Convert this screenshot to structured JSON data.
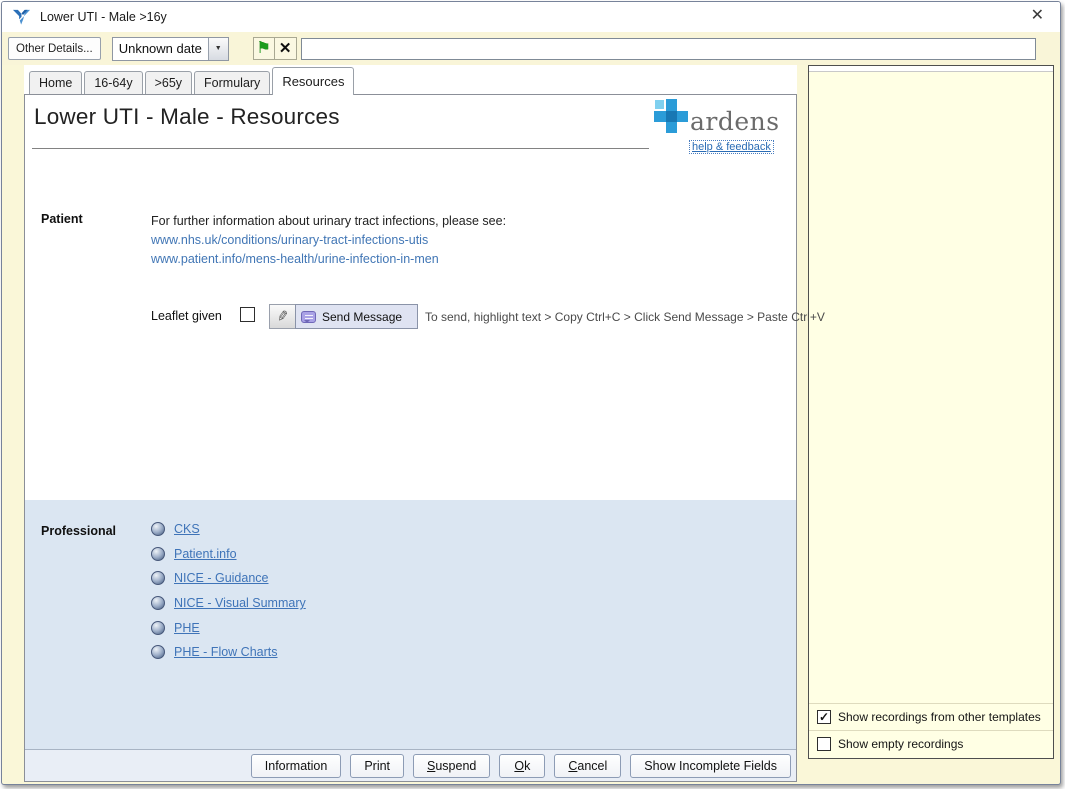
{
  "window": {
    "title": "Lower UTI - Male >16y"
  },
  "icons": {
    "close": "✕",
    "flag": "⚑",
    "clear": "✕",
    "dropdown": "▼",
    "pencil": "✎",
    "check": "✓"
  },
  "toolbar": {
    "other_details": "Other Details...",
    "date_value": "Unknown date",
    "search_value": ""
  },
  "tabs": [
    {
      "label": "Home",
      "active": false
    },
    {
      "label": "16-64y",
      "active": false
    },
    {
      "label": ">65y",
      "active": false
    },
    {
      "label": "Formulary",
      "active": false
    },
    {
      "label": "Resources",
      "active": true
    }
  ],
  "main": {
    "heading": "Lower UTI - Male - Resources",
    "logo": {
      "brand": "ardens",
      "help_link": "help & feedback"
    },
    "patient": {
      "section_label": "Patient",
      "intro": "For further information about urinary tract infections, please see:",
      "links": [
        "www.nhs.uk/conditions/urinary-tract-infections-utis",
        "www.patient.info/mens-health/urine-infection-in-men"
      ],
      "leaflet_label": "Leaflet given",
      "send_button": "Send Message",
      "send_hint": "To send, highlight text > Copy Ctrl+C > Click Send Message > Paste Ctrl+V"
    },
    "professional": {
      "section_label": "Professional",
      "links": [
        "CKS",
        "Patient.info",
        "NICE - Guidance",
        "NICE - Visual Summary",
        "PHE",
        "PHE - Flow Charts"
      ]
    },
    "footer_buttons": [
      {
        "pre": "Information",
        "key": "",
        "post": ""
      },
      {
        "pre": "Print",
        "key": "",
        "post": ""
      },
      {
        "pre": "",
        "key": "S",
        "post": "uspend"
      },
      {
        "pre": "",
        "key": "O",
        "post": "k"
      },
      {
        "pre": "",
        "key": "C",
        "post": "ancel"
      },
      {
        "pre": "Show Incomplete Fields",
        "key": "",
        "post": ""
      }
    ]
  },
  "right_panel": {
    "checkboxes": [
      {
        "label": "Show recordings from other templates",
        "checked": true
      },
      {
        "label": "Show empty recordings",
        "checked": false
      }
    ]
  },
  "colors": {
    "accent_blue": "#2b9cd8",
    "link_blue": "#3f74b8",
    "panel_yellow": "#ffffe4",
    "section_blue": "#dbe6f2",
    "toolbar_cream": "#f9f5d8",
    "flag_green": "#1c9c1c"
  }
}
